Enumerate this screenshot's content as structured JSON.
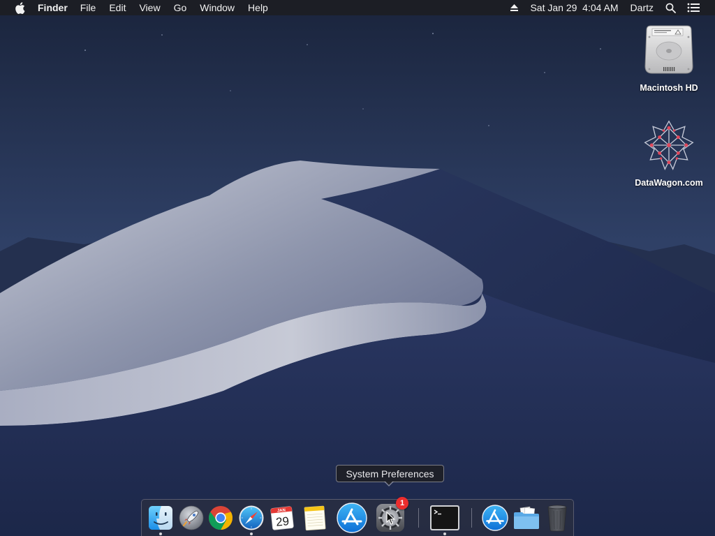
{
  "menubar": {
    "apple_icon": "apple-logo-icon",
    "app_name": "Finder",
    "menus": [
      "File",
      "Edit",
      "View",
      "Go",
      "Window",
      "Help"
    ],
    "datetime": "Sat Jan 29  4:04 AM",
    "user": "Dartz",
    "icons": [
      "eject-icon",
      "spotlight-search-icon",
      "notification-center-icon"
    ]
  },
  "desktop": {
    "icons": [
      {
        "label": "Macintosh HD",
        "icon": "hard-drive-icon"
      },
      {
        "label": "DataWagon.com",
        "icon": "datawagon-logo-icon"
      }
    ]
  },
  "tooltip": {
    "text": "System Preferences"
  },
  "dock": {
    "items": [
      {
        "icon": "finder-icon",
        "running": true
      },
      {
        "icon": "launchpad-icon",
        "running": false
      },
      {
        "icon": "chrome-icon",
        "running": false
      },
      {
        "icon": "safari-icon",
        "running": true
      },
      {
        "icon": "calendar-icon",
        "running": false,
        "month": "JAN",
        "day": "29"
      },
      {
        "icon": "notes-icon",
        "running": false
      },
      {
        "icon": "app-store-icon",
        "running": false
      },
      {
        "icon": "system-preferences-icon",
        "running": false,
        "badge": "1"
      },
      {
        "icon": "terminal-icon",
        "running": true
      },
      {
        "icon": "app-store-download-icon",
        "running": false
      },
      {
        "icon": "documents-folder-icon",
        "running": false
      },
      {
        "icon": "trash-icon",
        "running": false
      }
    ]
  },
  "colors": {
    "sky_top": "#1b2640",
    "sky_bottom": "#364a72",
    "dune_light": "#b8bccb",
    "dune_shadow": "#1f2b4d",
    "badge": "#ec2d2d"
  }
}
